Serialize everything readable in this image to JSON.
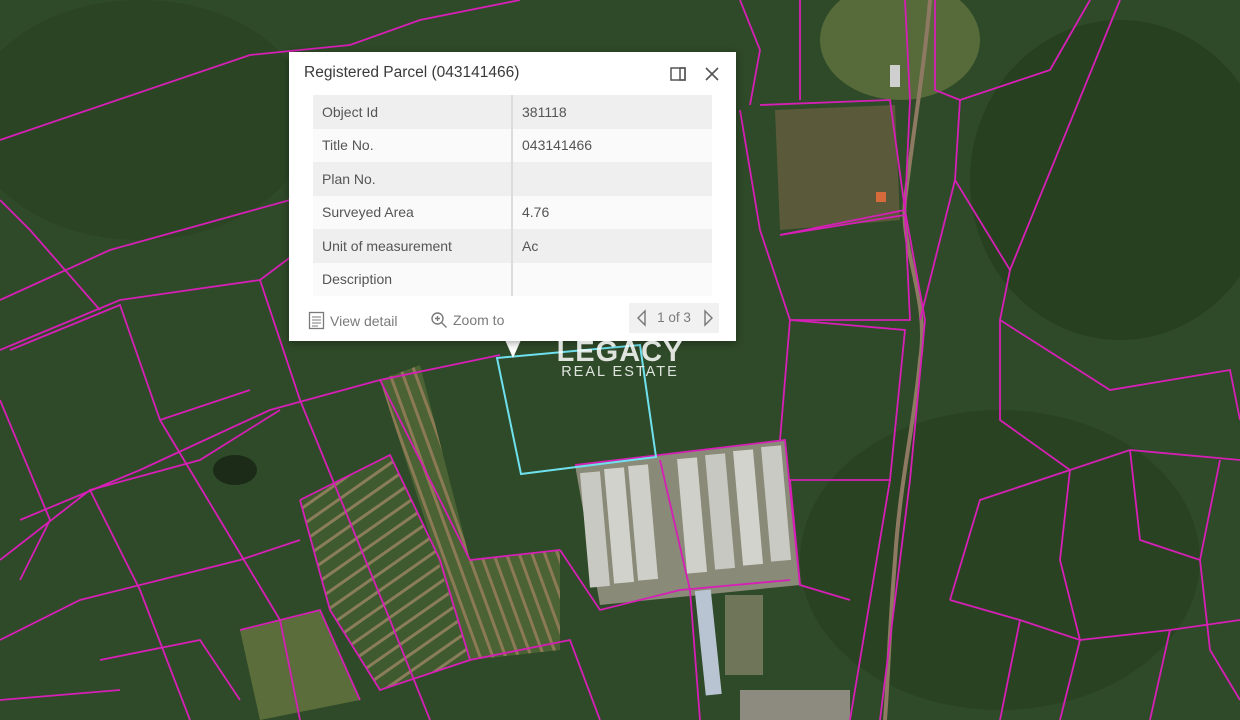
{
  "colors": {
    "parcel_boundary": "#d61fb6",
    "selected_parcel": "#6fe0ee",
    "forest": "#2f4a28",
    "popup_bg": "#ffffff"
  },
  "popup": {
    "title": "Registered Parcel (043141466)",
    "fields": [
      {
        "label": "Object Id",
        "value": "381118"
      },
      {
        "label": "Title No.",
        "value": "043141466"
      },
      {
        "label": "Plan No.",
        "value": ""
      },
      {
        "label": "Surveyed Area",
        "value": "4.76"
      },
      {
        "label": "Unit of measurement",
        "value": "Ac"
      },
      {
        "label": "Description",
        "value": ""
      }
    ],
    "actions": {
      "view_detail": "View detail",
      "zoom_to": "Zoom to"
    },
    "pagination": "1 of 3"
  },
  "watermark": {
    "line1": "LEGACY",
    "line2": "REAL ESTATE"
  },
  "icons": {
    "dock": "dock-icon",
    "close": "close-icon",
    "view_detail": "document-icon",
    "zoom_to": "zoom-in-icon",
    "prev": "chevron-left-icon",
    "next": "chevron-right-icon"
  }
}
